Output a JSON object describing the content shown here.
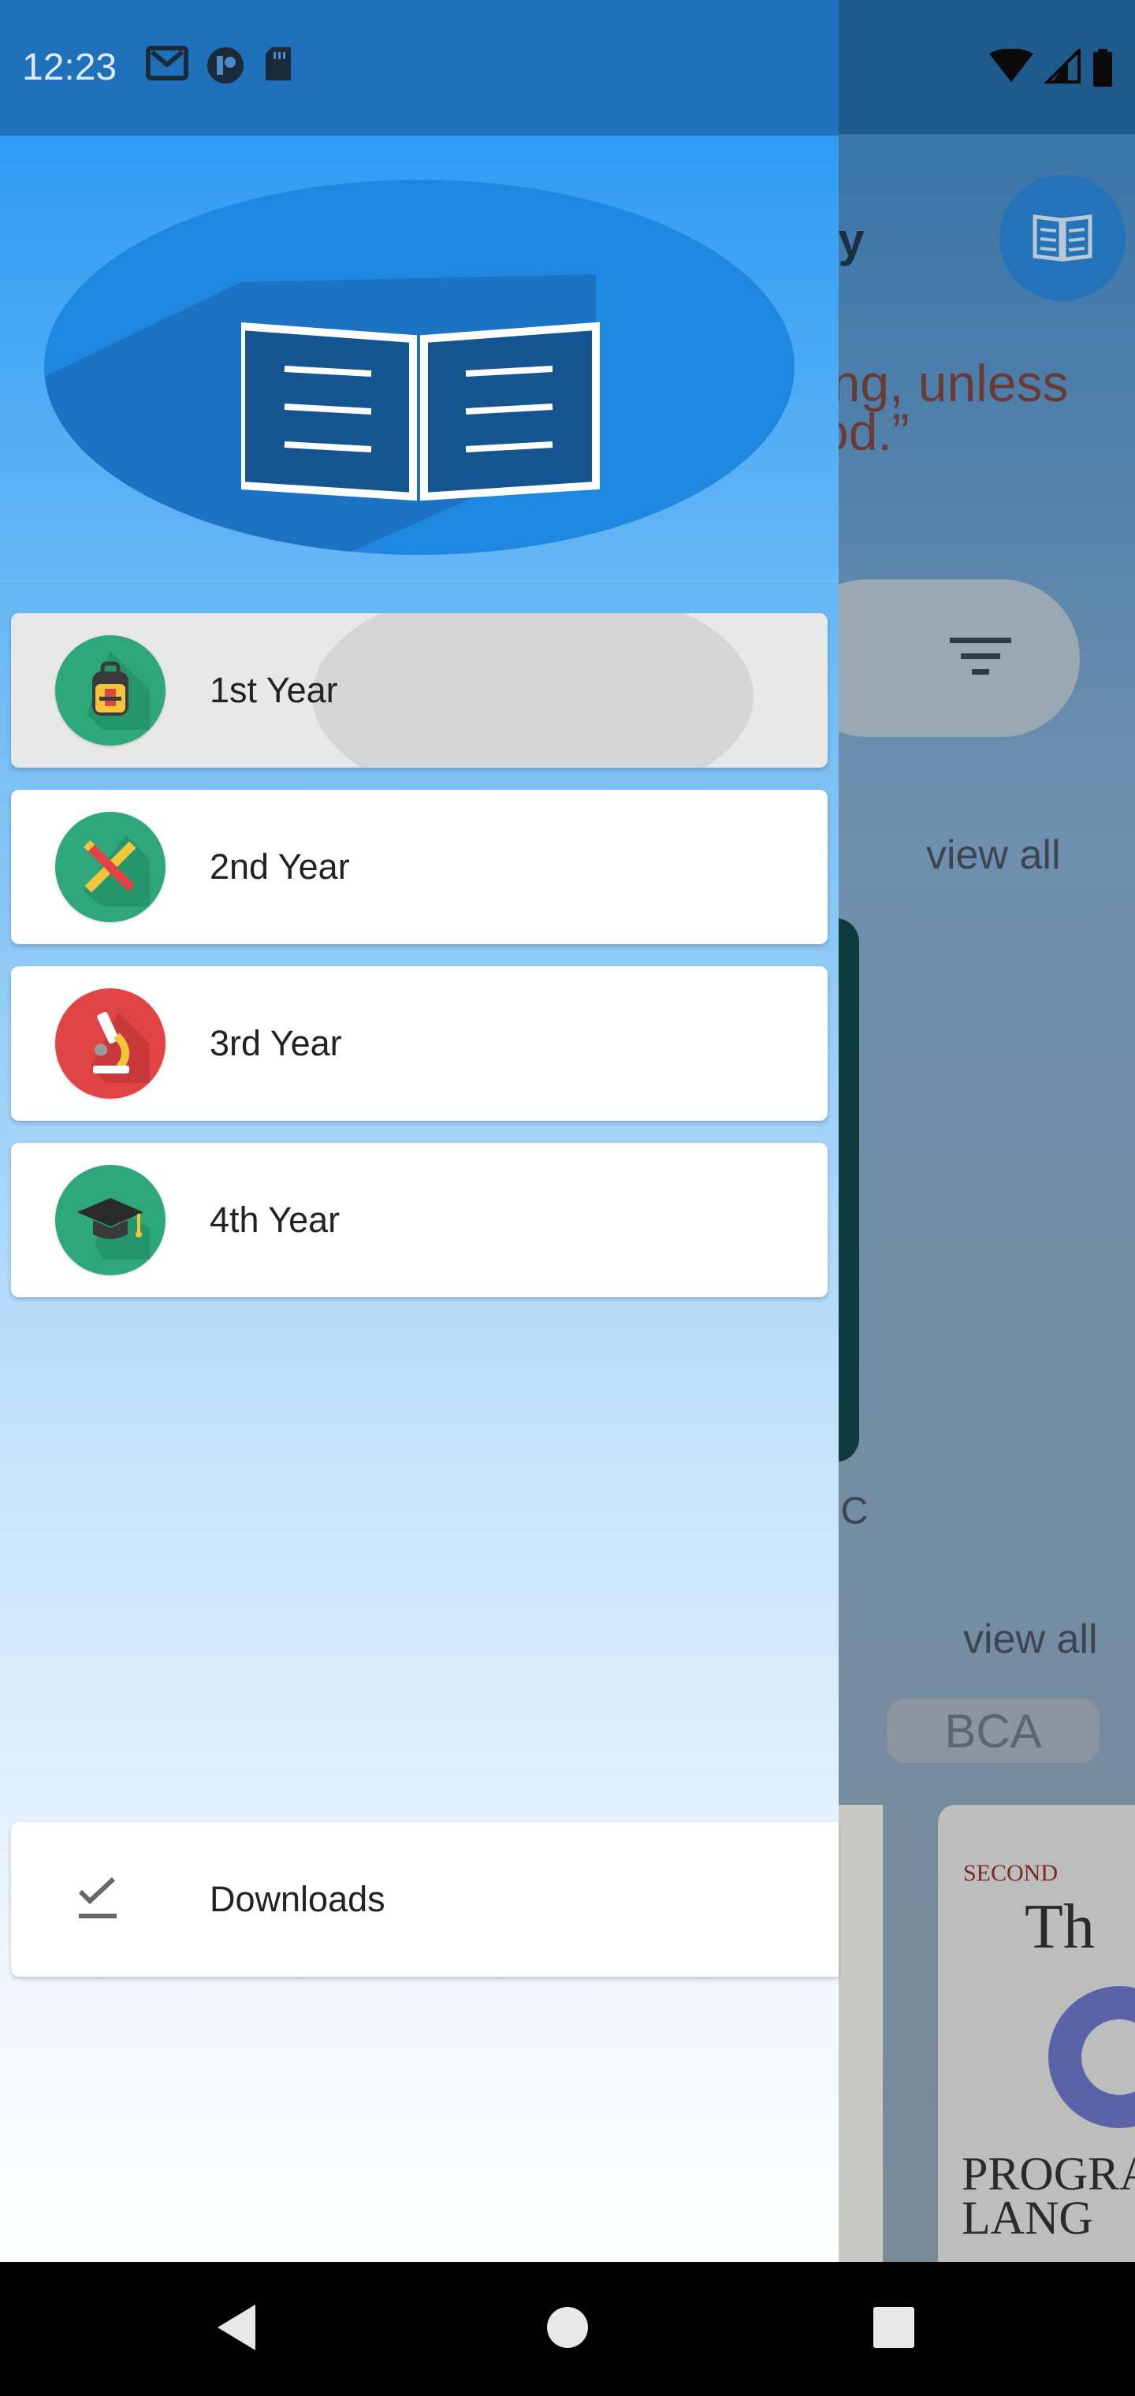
{
  "status_bar": {
    "time": "12:23",
    "left_icons": [
      "gmail-icon",
      "app-icon",
      "sd-card-icon"
    ],
    "right_icons": [
      "wifi-icon",
      "signal-icon",
      "battery-icon"
    ]
  },
  "background_app": {
    "title_fragment": "ry",
    "quote_line1": "ing, unless",
    "quote_line2": "od.”",
    "view_all_1": "view all",
    "view_all_2": "view all",
    "book_caption_fragment": "I C",
    "chip_label": "BCA",
    "book3_edition_fragment": "SECOND",
    "book3_title_fragment": "Th",
    "book3_subtitle_line1": "PROGRA",
    "book3_subtitle_line2": "LANG"
  },
  "drawer": {
    "header_icon": "open-book-icon",
    "menu_items": [
      {
        "label": "1st Year",
        "icon": "backpack-icon",
        "icon_bg": "#2ea87a",
        "selected": true
      },
      {
        "label": "2nd Year",
        "icon": "ruler-pencil-icon",
        "icon_bg": "#2ea87a",
        "selected": false
      },
      {
        "label": "3rd Year",
        "icon": "microscope-icon",
        "icon_bg": "#e04444",
        "selected": false
      },
      {
        "label": "4th Year",
        "icon": "graduation-cap-icon",
        "icon_bg": "#2ea87a",
        "selected": false
      }
    ],
    "downloads": {
      "label": "Downloads",
      "icon": "download-check-icon"
    }
  },
  "nav_bar": {
    "back": "back-icon",
    "home": "home-icon",
    "recents": "recents-icon"
  },
  "colors": {
    "drawer_top": "#2e9bf3",
    "drawer_bottom": "#ffffff",
    "status_bar": "#1e70ba",
    "logo_oval": "#1e88e0"
  }
}
